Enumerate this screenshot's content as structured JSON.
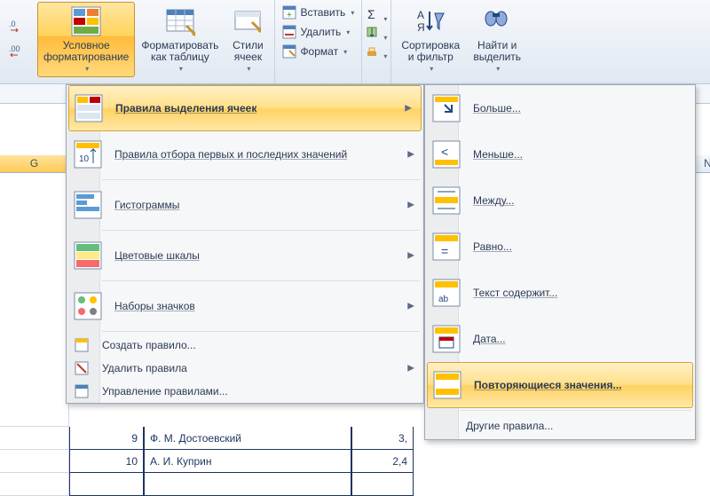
{
  "ribbon": {
    "cond_fmt": "Условное\nформатирование",
    "fmt_table": "Форматировать\nкак таблицу",
    "cell_styles": "Стили\nячеек",
    "insert": "Вставить",
    "delete": "Удалить",
    "format": "Формат",
    "sort_filter": "Сортировка\nи фильтр",
    "find_select": "Найти и\nвыделить"
  },
  "menu_main": {
    "highlight_rules": "Правила выделения ячеек",
    "top_bottom": "Правила отбора первых и последних значений",
    "data_bars": "Гистограммы",
    "color_scales": "Цветовые шкалы",
    "icon_sets": "Наборы значков",
    "new_rule": "Создать правило...",
    "clear_rules": "Удалить правила",
    "manage_rules": "Управление правилами..."
  },
  "menu_sub": {
    "greater": "Больше...",
    "less": "Меньше...",
    "between": "Между...",
    "equal": "Равно...",
    "text_contains": "Текст содержит...",
    "date": "Дата...",
    "duplicates": "Повторяющиеся значения...",
    "more_rules": "Другие правила..."
  },
  "columns": {
    "g": "G",
    "n": "N"
  },
  "table": {
    "rows": [
      {
        "n": "9",
        "name": "Ф. М. Достоевский",
        "v": "3,"
      },
      {
        "n": "10",
        "name": "А. И. Куприн",
        "v": "2,4"
      },
      {
        "n": "",
        "name": "",
        "v": ""
      }
    ]
  }
}
